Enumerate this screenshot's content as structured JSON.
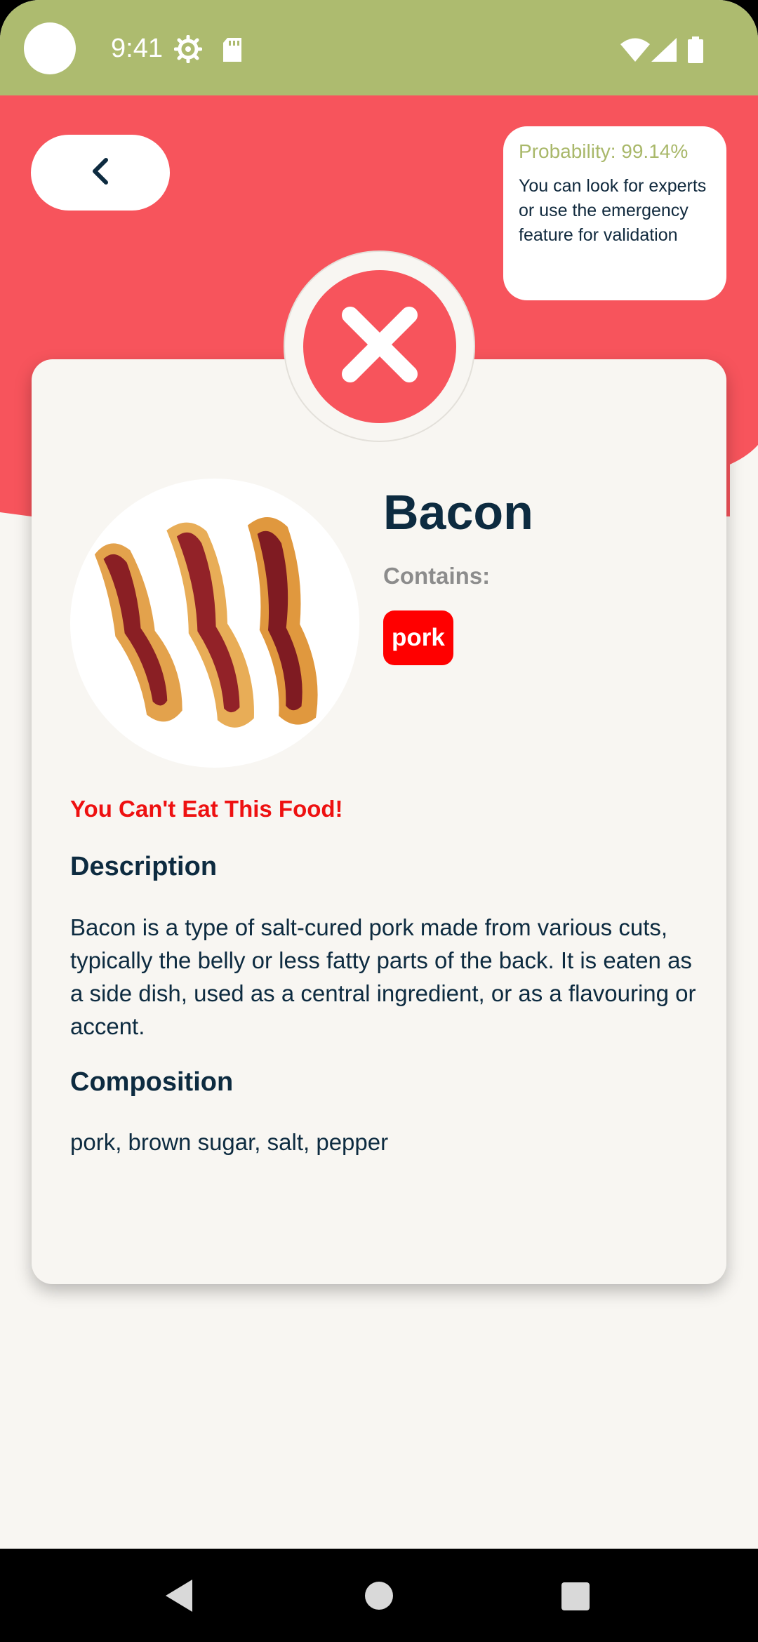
{
  "status_bar": {
    "time": "9:41"
  },
  "back_button": {
    "icon": "chevron-left-icon"
  },
  "probability": {
    "label": "Probability: 99.14%",
    "message": "You can look for experts or use the emergency feature for validation"
  },
  "result": {
    "icon": "close-x-icon",
    "status_color": "#f7545c"
  },
  "food": {
    "name": "Bacon",
    "contains_label": "Contains:",
    "allergens": [
      "pork"
    ],
    "warning": "You Can't Eat This Food!",
    "description_title": "Description",
    "description": "Bacon is a type of salt-cured pork made from various cuts, typically the belly or less fatty parts of the back. It is eaten as a side dish, used as a central ingredient, or as a flavouring or accent.",
    "composition_title": "Composition",
    "composition": "pork, brown sugar, salt, pepper"
  },
  "colors": {
    "accent_red": "#f7545c",
    "status_bar": "#adbb6f",
    "text_dark": "#0d2b40",
    "warning_red": "#ee1111"
  }
}
